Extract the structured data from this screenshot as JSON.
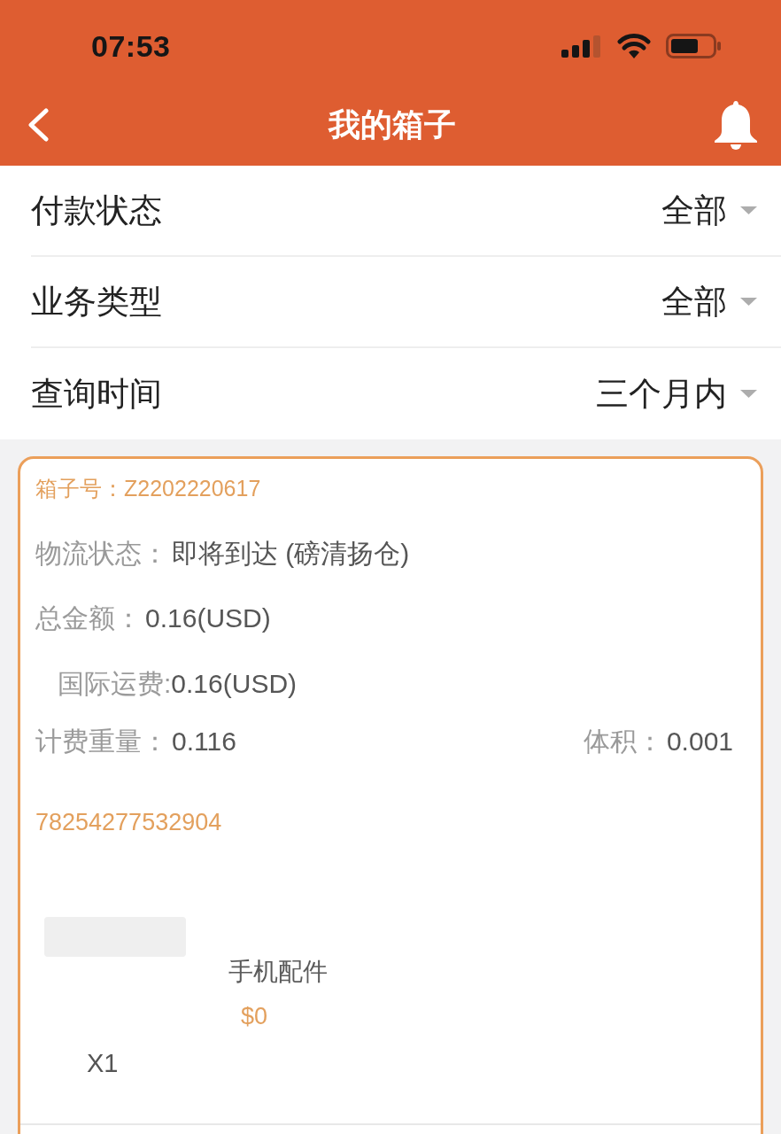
{
  "status_bar": {
    "time": "07:53"
  },
  "nav_bar": {
    "title": "我的箱子"
  },
  "filters": [
    {
      "label": "付款状态",
      "value": "全部"
    },
    {
      "label": "业务类型",
      "value": "全部"
    },
    {
      "label": "查询时间",
      "value": "三个月内"
    }
  ],
  "box_card": {
    "box_number": "箱子号：Z2202220617",
    "details": [
      {
        "kind": "line",
        "label": "物流状态：",
        "value": "即将到达 (磅清扬仓)"
      },
      {
        "kind": "line",
        "label": "总金额：",
        "value": "0.16(USD)"
      },
      {
        "kind": "sub",
        "label": "国际运费:",
        "value": "0.16(USD)"
      },
      {
        "kind": "pair",
        "label": "计费重量：",
        "value": "0.116",
        "right": {
          "label": "体积：",
          "value": "0.001"
        }
      }
    ],
    "tracking_number": "78254277532904",
    "items": [
      {
        "name": "手机配件",
        "price": "$0",
        "quantity": "X1"
      }
    ]
  }
}
